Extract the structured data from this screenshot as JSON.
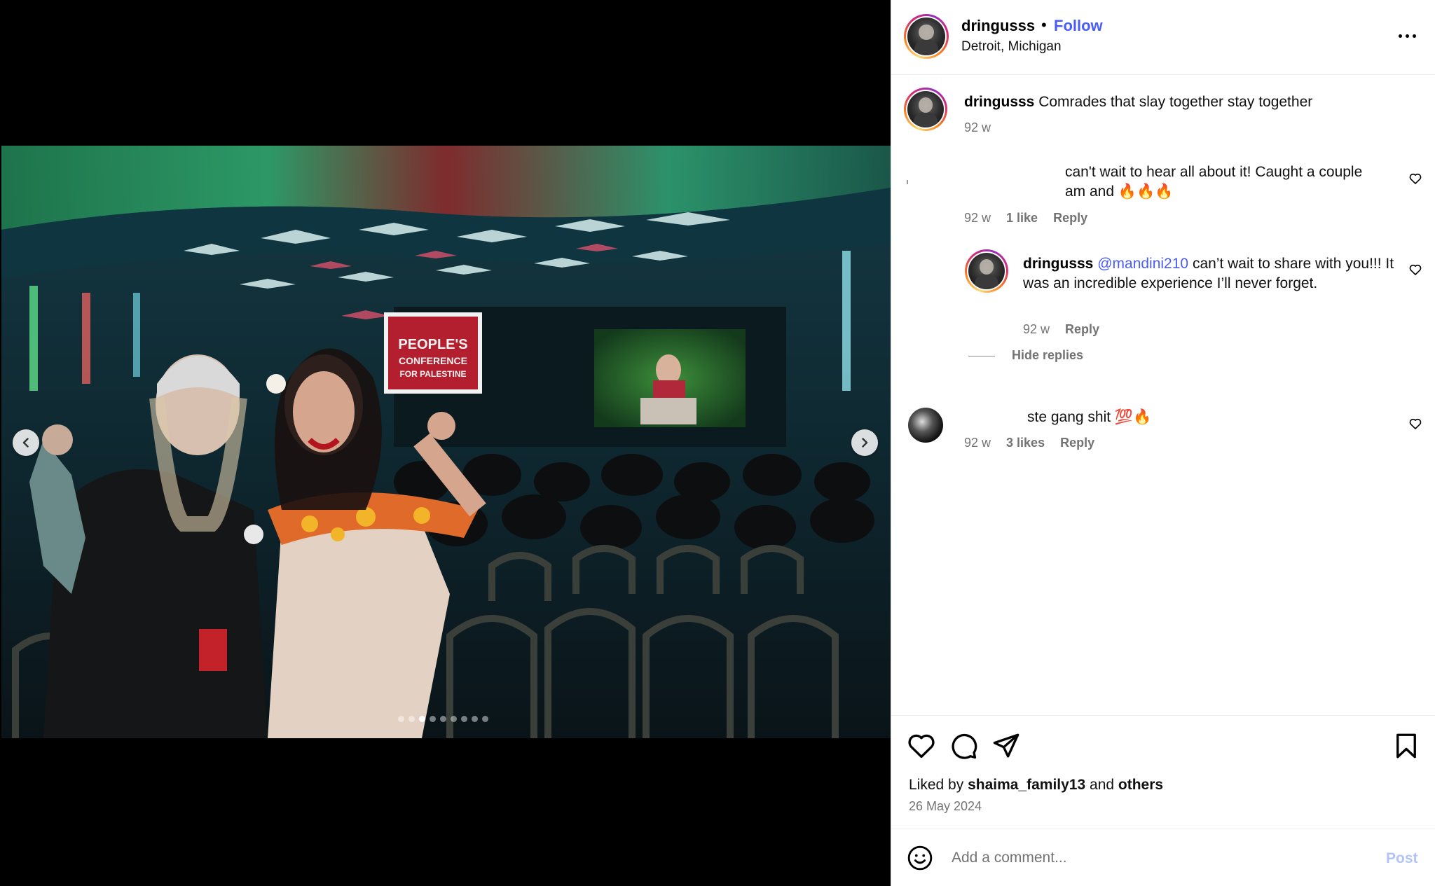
{
  "post": {
    "username": "dringusss",
    "separator": "•",
    "follow_label": "Follow",
    "location": "Detroit, Michigan"
  },
  "caption": {
    "username": "dringusss",
    "text": "Comrades that slay together stay together",
    "time": "92 w"
  },
  "comments": [
    {
      "text_line1": "can't wait to hear all about it! Caught a couple",
      "text_line2": "am and 🔥🔥🔥",
      "time": "92 w",
      "likes": "1 like",
      "reply_label": "Reply",
      "replies": [
        {
          "username": "dringusss",
          "mention": "@mandini210",
          "text": "can’t wait to share with you!!! It was an incredible experience I’ll never forget.",
          "time": "92 w",
          "reply_label": "Reply"
        }
      ],
      "hide_replies_label": "Hide replies"
    },
    {
      "text": "ste gang shit 💯🔥",
      "time": "92 w",
      "likes": "3 likes",
      "reply_label": "Reply"
    }
  ],
  "footer": {
    "liked_by_prefix": "Liked by",
    "liked_by_user": "shaima_family13",
    "liked_by_and": "and",
    "liked_by_others": "others",
    "date": "26 May 2024",
    "comment_placeholder": "Add a comment...",
    "post_label": "Post"
  },
  "carousel": {
    "total_slides": 9,
    "active_slide": 3
  },
  "photo": {
    "banner_text_1": "PEOPLE'S",
    "banner_text_2": "CONFERENCE",
    "banner_text_3": "FOR PALESTINE"
  },
  "colors": {
    "follow_blue": "#4a5df9",
    "meta_gray": "#737373",
    "post_button_disabled": "#b3c4fb"
  }
}
